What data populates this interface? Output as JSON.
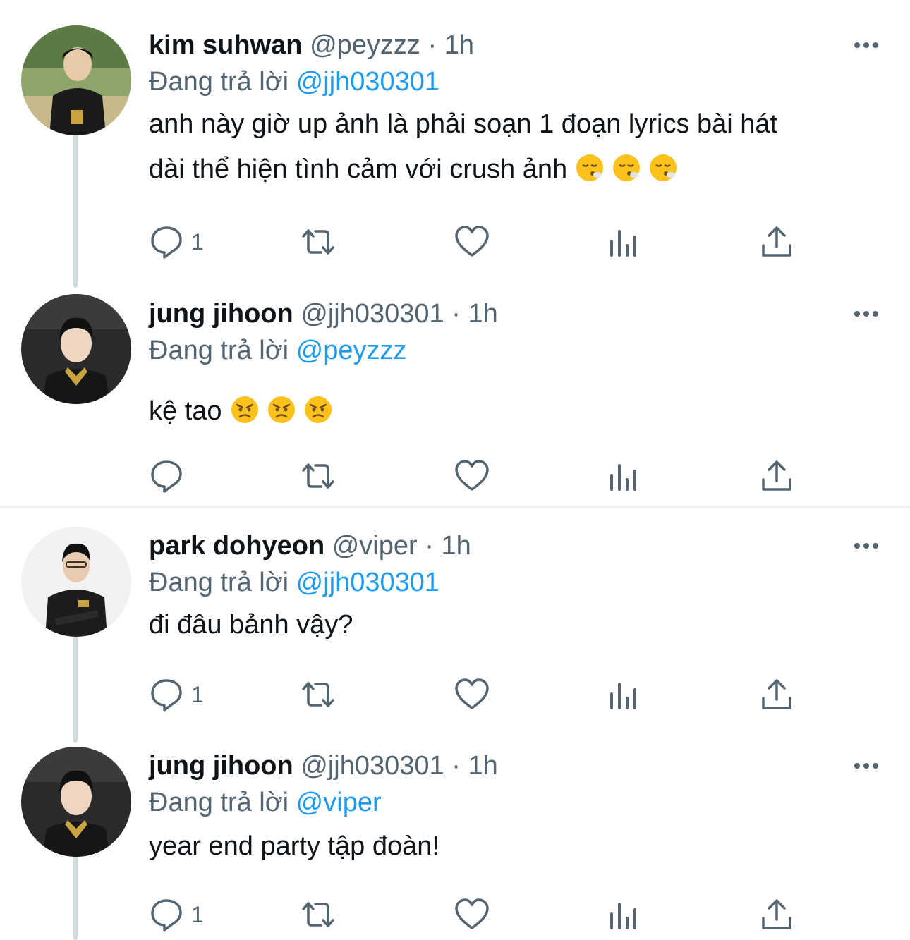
{
  "reply_prefix": "Đang trả lời",
  "colors": {
    "text": "#0f1419",
    "muted": "#536471",
    "link": "#1d9bf0",
    "thread_line": "#cfd9de"
  },
  "tweets": [
    {
      "name": "kim suhwan",
      "handle": "@peyzzz",
      "time": "1h",
      "reply_to": "@jjh030301",
      "text_lines": [
        "anh này giờ up ảnh là phải soạn 1 đoạn lyrics bài hát",
        "dài thể hiện tình cảm với crush ảnh"
      ],
      "emoji": [
        "dizzy-face-exhale-emoji",
        "dizzy-face-exhale-emoji",
        "dizzy-face-exhale-emoji"
      ],
      "reply_count": "1"
    },
    {
      "name": "jung jihoon",
      "handle": "@jjh030301",
      "time": "1h",
      "reply_to": "@peyzzz",
      "text_lines": [
        "kệ tao"
      ],
      "emoji": [
        "angry-face-emoji",
        "angry-face-emoji",
        "angry-face-emoji"
      ],
      "reply_count": ""
    },
    {
      "name": "park dohyeon",
      "handle": "@viper",
      "time": "1h",
      "reply_to": "@jjh030301",
      "text_lines": [
        "đi đâu bảnh vậy?"
      ],
      "emoji": [],
      "reply_count": "1"
    },
    {
      "name": "jung jihoon",
      "handle": "@jjh030301",
      "time": "1h",
      "reply_to": "@viper",
      "text_lines": [
        "year end party tập đoàn!"
      ],
      "emoji": [],
      "reply_count": "1"
    }
  ],
  "action_icons": [
    "reply-icon",
    "retweet-icon",
    "like-icon",
    "analytics-icon",
    "share-icon"
  ]
}
